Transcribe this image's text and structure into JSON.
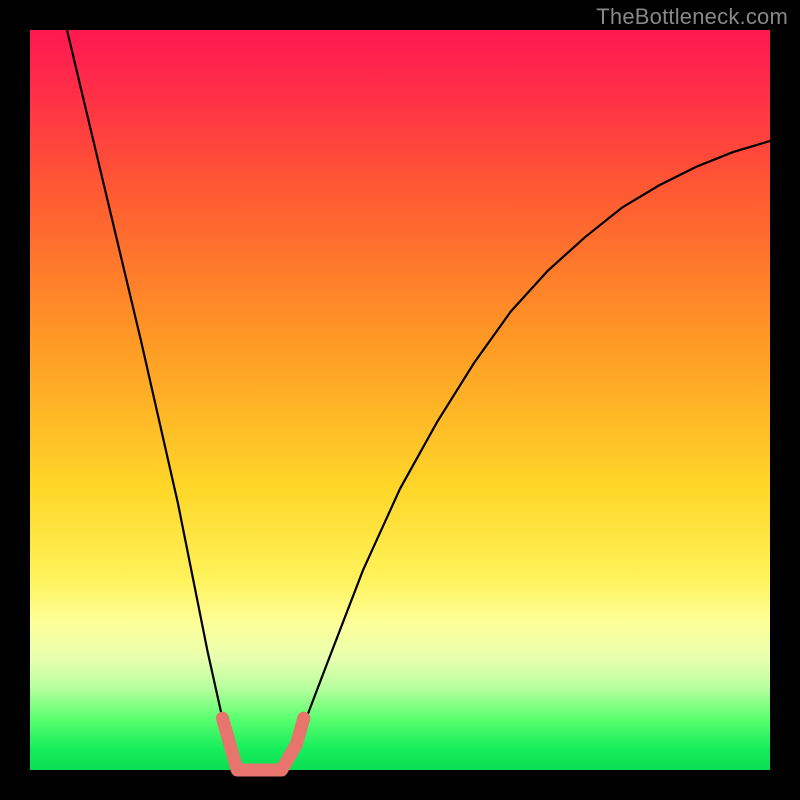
{
  "watermark": "TheBottleneck.com",
  "colors": {
    "bg": "#000000",
    "watermark": "#888888",
    "curve": "#000000",
    "highlight_stroke": "#e7746d"
  },
  "chart_data": {
    "type": "line",
    "title": "",
    "xlabel": "",
    "ylabel": "",
    "xlim": [
      0,
      100
    ],
    "ylim": [
      0,
      100
    ],
    "grid": false,
    "series": [
      {
        "name": "bottleneck-curve",
        "x": [
          5,
          10,
          15,
          20,
          22,
          24,
          26,
          27,
          28,
          30,
          32,
          34,
          36,
          40,
          45,
          50,
          55,
          60,
          65,
          70,
          75,
          80,
          85,
          90,
          95,
          100
        ],
        "values": [
          100,
          79,
          58,
          36,
          26,
          16,
          7,
          3.5,
          0,
          0,
          0,
          0,
          3.5,
          14,
          27,
          38,
          47,
          55,
          62,
          67.5,
          72,
          76,
          79,
          81.5,
          83.5,
          85
        ]
      },
      {
        "name": "salmon-highlight",
        "x": [
          26,
          27,
          28,
          30,
          32,
          34,
          36,
          37
        ],
        "values": [
          7,
          3.5,
          0,
          0,
          0,
          0,
          3.5,
          7
        ]
      }
    ]
  }
}
